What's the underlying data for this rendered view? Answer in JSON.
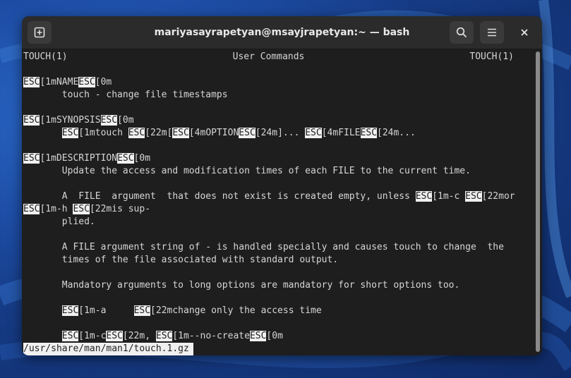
{
  "window": {
    "title": "mariyasayrapetyan@msayjrapetyan:~ — bash",
    "new_tab_icon": "new-tab-icon",
    "search_icon": "search-icon",
    "menu_icon": "hamburger-menu-icon",
    "close_icon": "close-icon"
  },
  "man": {
    "header_left": "TOUCH(1)",
    "header_center": "User Commands",
    "header_right": "TOUCH(1)",
    "esc": "ESC",
    "name_pre": "[1mNAME",
    "name_post": "[0m",
    "name_desc": "       touch - change file timestamps",
    "synopsis_pre": "[1mSYNOPSIS",
    "synopsis_post": "[0m",
    "syn_indent": "       ",
    "syn_a": "[1mtouch ",
    "syn_b": "[22m[",
    "syn_c": "[4mOPTION",
    "syn_d": "[24m]... ",
    "syn_e": "[4mFILE",
    "syn_f": "[24m...",
    "description_pre": "[1mDESCRIPTION",
    "description_post": "[0m",
    "desc_1": "       Update the access and modification times of each FILE to the current time.",
    "desc_2a": "       A  FILE  argument  that does not exist is created empty, unless ",
    "desc_2b": "[1m-c ",
    "desc_2c": "[22mor",
    "desc_3a": "[1m-h ",
    "desc_3b": "[22mis sup-",
    "desc_4": "       plied.",
    "desc_5": "       A FILE argument string of - is handled specially and causes touch to change  the",
    "desc_6": "       times of the file associated with standard output.",
    "desc_7": "       Mandatory arguments to long options are mandatory for short options too.",
    "opt_indent": "       ",
    "opt_a1": "[1m-a     ",
    "opt_a2": "[22mchange only the access time",
    "opt_c1": "[1m-c",
    "opt_c2": "[22m, ",
    "opt_c3": "[1m--no-create",
    "opt_c4": "[0m",
    "status": "/usr/share/man/man1/touch.1.gz"
  }
}
